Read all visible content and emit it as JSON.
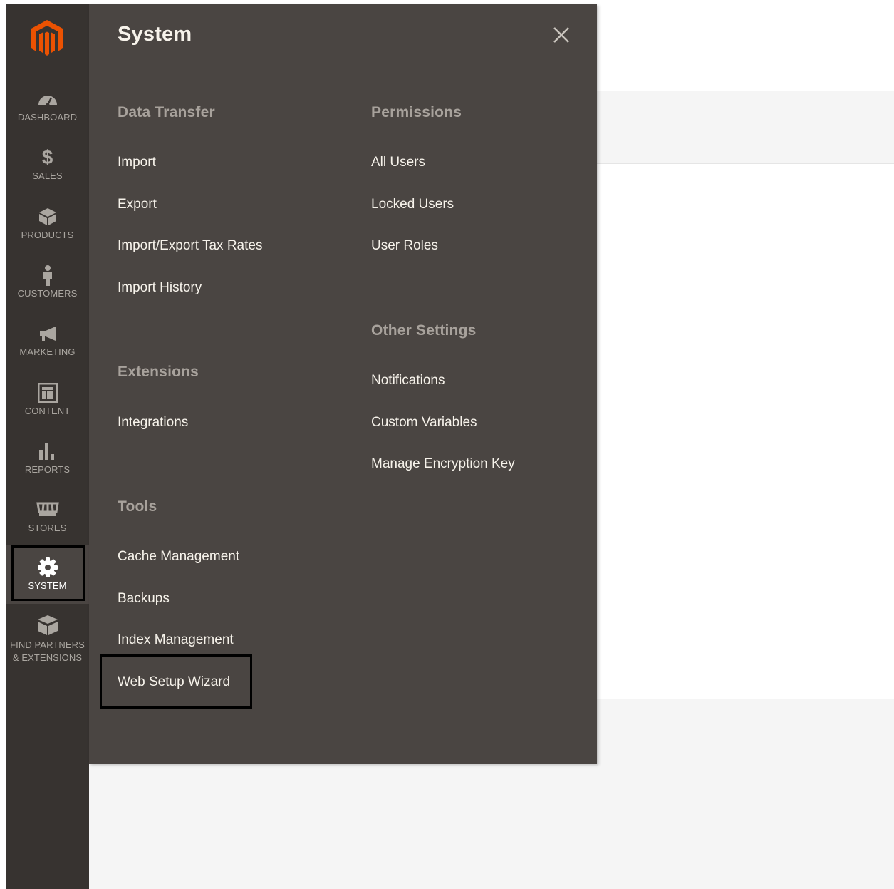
{
  "nav": {
    "items": [
      {
        "label": "DASHBOARD"
      },
      {
        "label": "SALES"
      },
      {
        "label": "PRODUCTS"
      },
      {
        "label": "CUSTOMERS"
      },
      {
        "label": "MARKETING"
      },
      {
        "label": "CONTENT"
      },
      {
        "label": "REPORTS"
      },
      {
        "label": "STORES"
      },
      {
        "label": "SYSTEM",
        "active": true
      },
      {
        "label_line1": "FIND PARTNERS",
        "label_line2": "& EXTENSIONS"
      }
    ]
  },
  "flyout": {
    "title": "System",
    "groups": {
      "data_transfer": {
        "title": "Data Transfer",
        "items": [
          "Import",
          "Export",
          "Import/Export Tax Rates",
          "Import History"
        ]
      },
      "extensions": {
        "title": "Extensions",
        "items": [
          "Integrations"
        ]
      },
      "tools": {
        "title": "Tools",
        "items": [
          "Cache Management",
          "Backups",
          "Index Management",
          "Web Setup Wizard"
        ]
      },
      "permissions": {
        "title": "Permissions",
        "items": [
          "All Users",
          "Locked Users",
          "User Roles"
        ]
      },
      "other_settings": {
        "title": "Other Settings",
        "items": [
          "Notifications",
          "Custom Variables",
          "Manage Encryption Key"
        ]
      }
    }
  },
  "colors": {
    "nav_bg": "#373330",
    "flyout_bg": "#4a4542",
    "logo_orange": "#eb5202",
    "link_text": "#f7f3eb",
    "group_title": "#a8a29c",
    "nav_text": "#aaa6a0"
  },
  "icons": {
    "logo": "magento-logo-icon",
    "dashboard": "speedometer-icon",
    "sales": "dollar-icon",
    "products": "cube-icon",
    "customers": "person-icon",
    "marketing": "megaphone-icon",
    "content": "layout-icon",
    "reports": "bar-chart-icon",
    "stores": "storefront-icon",
    "system": "gear-icon",
    "find_partners": "boxes-icon",
    "close": "close-icon"
  }
}
